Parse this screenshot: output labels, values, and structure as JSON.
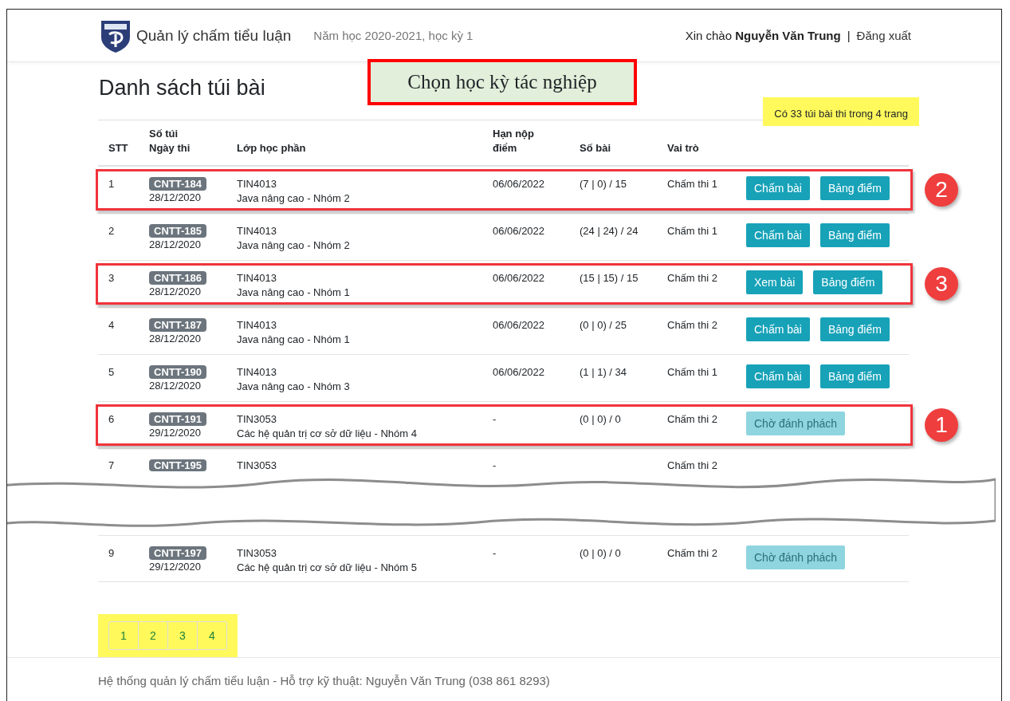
{
  "header": {
    "app_title": "Quản lý chấm tiểu luận",
    "semester": "Năm học 2020-2021, học kỳ 1",
    "greeting": "Xin chào **Nguyễn Văn Trung**",
    "separator": "|",
    "logout": "Đăng xuất"
  },
  "annotation": {
    "text": "Chọn học kỳ tác nghiệp"
  },
  "page_title": "Danh sách túi bài",
  "summary": "Có 33 túi bài thi trong 4 trang",
  "table": {
    "columns": [
      "STT",
      "Số túi\nNgày thi",
      "Lớp học phần",
      "Hạn nộp\nđiểm",
      "Số bài",
      "Vai trò"
    ],
    "rows": [
      {
        "kind": "full",
        "stt": "1",
        "code": "CNTT-184",
        "date": "28/12/2020",
        "course_code": "TIN4013",
        "course_name": "Java nâng cao - Nhóm 2",
        "deadline": "06/06/2022",
        "count": "(7 | 0) / 15",
        "role": "Chấm thi 1",
        "buttons": [
          {
            "label": "Chấm bài",
            "disabled": false
          },
          {
            "label": "Bảng điểm",
            "disabled": false
          }
        ],
        "callout": "2"
      },
      {
        "kind": "full",
        "stt": "2",
        "code": "CNTT-185",
        "date": "28/12/2020",
        "course_code": "TIN4013",
        "course_name": "Java nâng cao - Nhóm 2",
        "deadline": "06/06/2022",
        "count": "(24 | 24) / 24",
        "role": "Chấm thi 1",
        "buttons": [
          {
            "label": "Chấm bài",
            "disabled": false
          },
          {
            "label": "Bảng điểm",
            "disabled": false
          }
        ]
      },
      {
        "kind": "full",
        "stt": "3",
        "code": "CNTT-186",
        "date": "28/12/2020",
        "course_code": "TIN4013",
        "course_name": "Java nâng cao - Nhóm 1",
        "deadline": "06/06/2022",
        "count": "(15 | 15) / 15",
        "role": "Chấm thi 2",
        "buttons": [
          {
            "label": "Xem bài",
            "disabled": false
          },
          {
            "label": "Bảng điểm",
            "disabled": false
          }
        ],
        "callout": "3"
      },
      {
        "kind": "full",
        "stt": "4",
        "code": "CNTT-187",
        "date": "28/12/2020",
        "course_code": "TIN4013",
        "course_name": "Java nâng cao - Nhóm 1",
        "deadline": "06/06/2022",
        "count": "(0 | 0) / 25",
        "role": "Chấm thi 2",
        "buttons": [
          {
            "label": "Chấm bài",
            "disabled": false
          },
          {
            "label": "Bảng điểm",
            "disabled": false
          }
        ]
      },
      {
        "kind": "full",
        "stt": "5",
        "code": "CNTT-190",
        "date": "28/12/2020",
        "course_code": "TIN4013",
        "course_name": "Java nâng cao - Nhóm 3",
        "deadline": "06/06/2022",
        "count": "(1 | 1) / 34",
        "role": "Chấm thi 1",
        "buttons": [
          {
            "label": "Chấm bài",
            "disabled": false
          },
          {
            "label": "Bảng điểm",
            "disabled": false
          }
        ]
      },
      {
        "kind": "full",
        "stt": "6",
        "code": "CNTT-191",
        "date": "29/12/2020",
        "course_code": "TIN3053",
        "course_name": "Các hệ quản trị cơ sở dữ liệu - Nhóm 4",
        "deadline": "-",
        "count": "(0 | 0) / 0",
        "role": "Chấm thi 2",
        "buttons": [
          {
            "label": "Chờ đánh phách",
            "disabled": true
          }
        ],
        "callout": "1"
      },
      {
        "kind": "torn",
        "stt": "7",
        "code": "CNTT-195",
        "course_code": "TIN3053",
        "deadline": "-",
        "role": "Chấm thi 2"
      },
      {
        "kind": "full",
        "stt": "9",
        "code": "CNTT-197",
        "date": "29/12/2020",
        "course_code": "TIN3053",
        "course_name": "Các hệ quản trị cơ sở dữ liệu - Nhóm 5",
        "deadline": "-",
        "count": "(0 | 0) / 0",
        "role": "Chấm thi 2",
        "buttons": [
          {
            "label": "Chờ đánh phách",
            "disabled": true
          }
        ]
      }
    ]
  },
  "pagination": [
    {
      "label": "1",
      "selected": false
    },
    {
      "label": "2",
      "selected": false
    },
    {
      "label": "3",
      "selected": false
    },
    {
      "label": "4",
      "selected": false
    }
  ],
  "footer": "Hệ thống quản lý chấm tiểu luận - Hỗ trợ kỹ thuật: Nguyễn Văn Trung (038 861 8293)"
}
